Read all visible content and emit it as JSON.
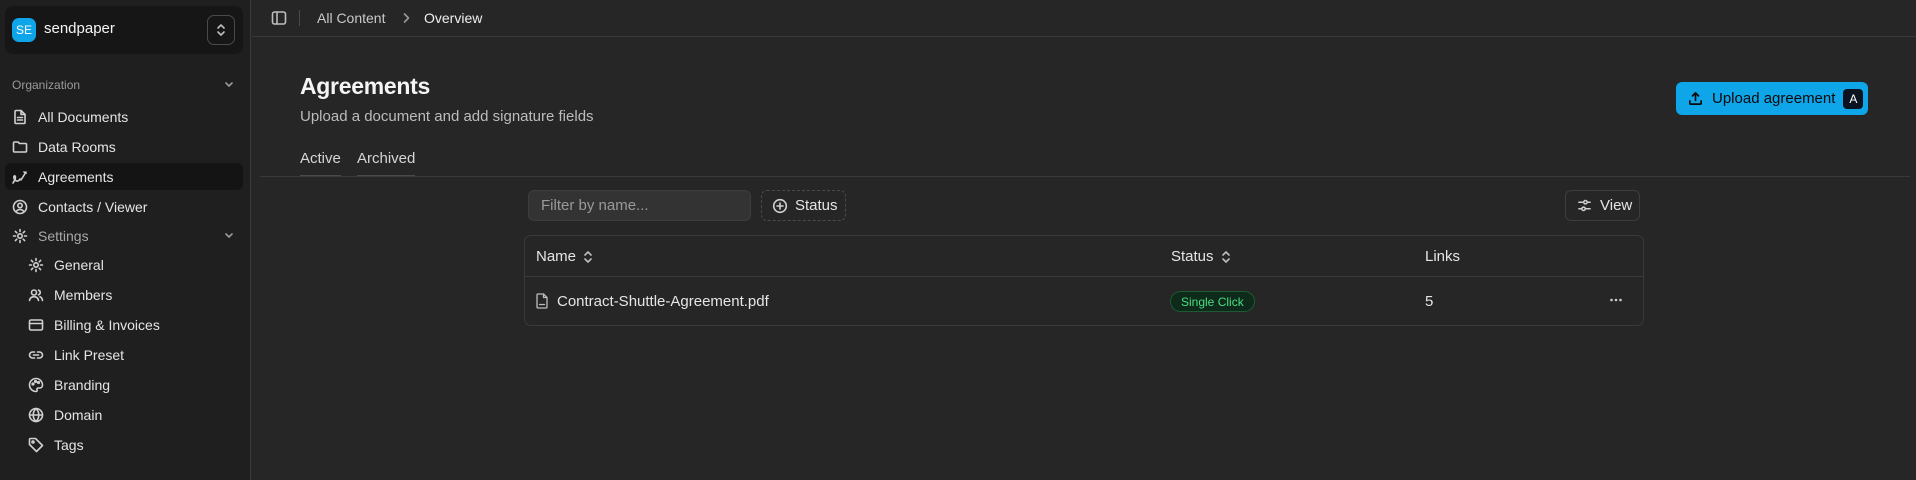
{
  "org": {
    "badge": "SE",
    "name": "sendpaper"
  },
  "sidebar": {
    "section_label": "Organization",
    "items": [
      {
        "label": "All Documents",
        "icon": "document-icon"
      },
      {
        "label": "Data Rooms",
        "icon": "folder-icon"
      },
      {
        "label": "Agreements",
        "icon": "signature-icon",
        "active": true
      },
      {
        "label": "Contacts / Viewer",
        "icon": "user-circle-icon"
      },
      {
        "label": "Settings",
        "icon": "gear-icon"
      }
    ],
    "settings_items": [
      {
        "label": "General",
        "icon": "gear-icon"
      },
      {
        "label": "Members",
        "icon": "users-icon"
      },
      {
        "label": "Billing & Invoices",
        "icon": "credit-card-icon"
      },
      {
        "label": "Link Preset",
        "icon": "link-icon"
      },
      {
        "label": "Branding",
        "icon": "palette-icon"
      },
      {
        "label": "Domain",
        "icon": "globe-icon"
      },
      {
        "label": "Tags",
        "icon": "tag-icon"
      }
    ]
  },
  "breadcrumb": {
    "root": "All Content",
    "current": "Overview"
  },
  "header": {
    "title": "Agreements",
    "subtitle": "Upload a document and add signature fields",
    "upload_label": "Upload agreement",
    "upload_shortcut": "A",
    "accent": "#0ea5e9"
  },
  "tabs": [
    {
      "label": "Active"
    },
    {
      "label": "Archived"
    }
  ],
  "toolbar": {
    "filter_placeholder": "Filter by name...",
    "status_label": "Status",
    "view_label": "View"
  },
  "table": {
    "columns": [
      "Name",
      "Status",
      "Links"
    ],
    "rows": [
      {
        "name": "Contract-Shuttle-Agreement.pdf",
        "status": "Single Click",
        "links": "5",
        "status_color": "#4ade80"
      }
    ]
  }
}
